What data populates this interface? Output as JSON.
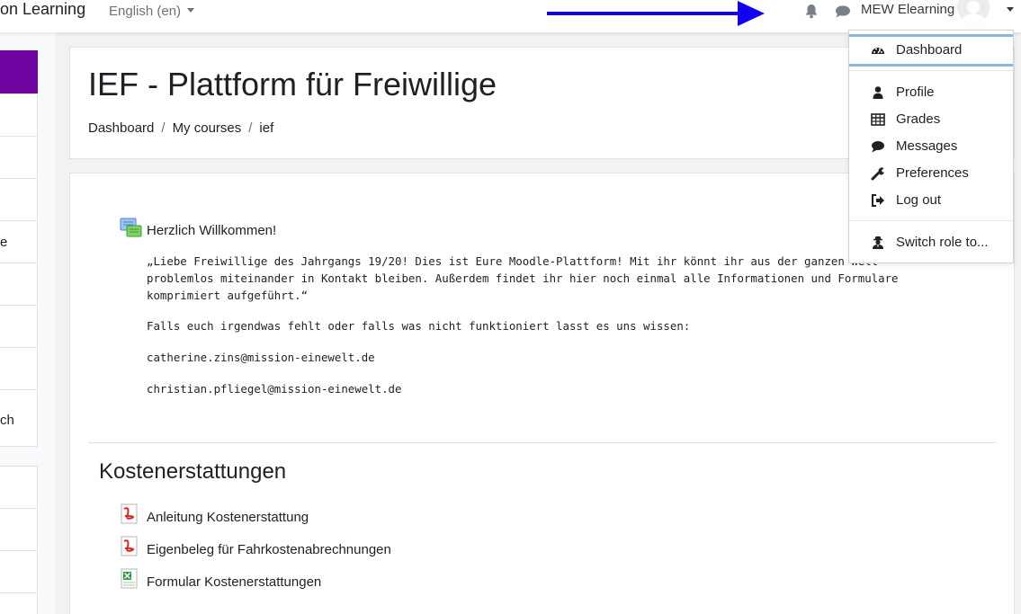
{
  "navbar": {
    "brand": "on Learning",
    "language": "English (en)",
    "username": "MEW Elearning"
  },
  "sidebar": {
    "items": [
      "",
      "",
      "",
      "e",
      "",
      "",
      "ch",
      "",
      "",
      "",
      ""
    ]
  },
  "header": {
    "title": "IEF - Plattform für Freiwillige",
    "breadcrumb": [
      "Dashboard",
      "My courses",
      "ief"
    ]
  },
  "welcome": {
    "title": "Herzlich Willkommen!",
    "lines": [
      "„Liebe Freiwillige des Jahrgangs 19/20! Dies ist Eure Moodle-Plattform! Mit ihr könnt ihr aus der ganzen Welt",
      "problemlos miteinander in Kontakt bleiben. Außerdem findet ihr hier noch einmal alle Informationen und Formulare",
      "komprimiert aufgeführt.“",
      "Falls euch irgendwas fehlt oder falls was nicht funktioniert lasst es uns wissen:",
      "catherine.zins@mission-einewelt.de",
      "christian.pfliegel@mission-einewelt.de"
    ]
  },
  "section": {
    "title": "Kostenerstattungen",
    "resources": [
      {
        "label": "Anleitung Kostenerstattung",
        "type": "pdf-icon"
      },
      {
        "label": "Eigenbeleg für Fahrkostenabrechnungen",
        "type": "pdf-icon"
      },
      {
        "label": "Formular Kostenerstattungen",
        "type": "spreadsheet-icon"
      }
    ]
  },
  "user_menu": {
    "items": [
      {
        "label": "Dashboard",
        "icon": "dashboard-icon"
      },
      {
        "label": "Profile",
        "icon": "user-icon"
      },
      {
        "label": "Grades",
        "icon": "table-icon"
      },
      {
        "label": "Messages",
        "icon": "comment-icon"
      },
      {
        "label": "Preferences",
        "icon": "wrench-icon"
      },
      {
        "label": "Log out",
        "icon": "sign-out-icon"
      },
      {
        "label": "Switch role to...",
        "icon": "user-secret-icon"
      }
    ]
  },
  "colors": {
    "accent": "#6f03a0",
    "arrow": "#1400f0",
    "active_border": "#8fb4e3"
  }
}
